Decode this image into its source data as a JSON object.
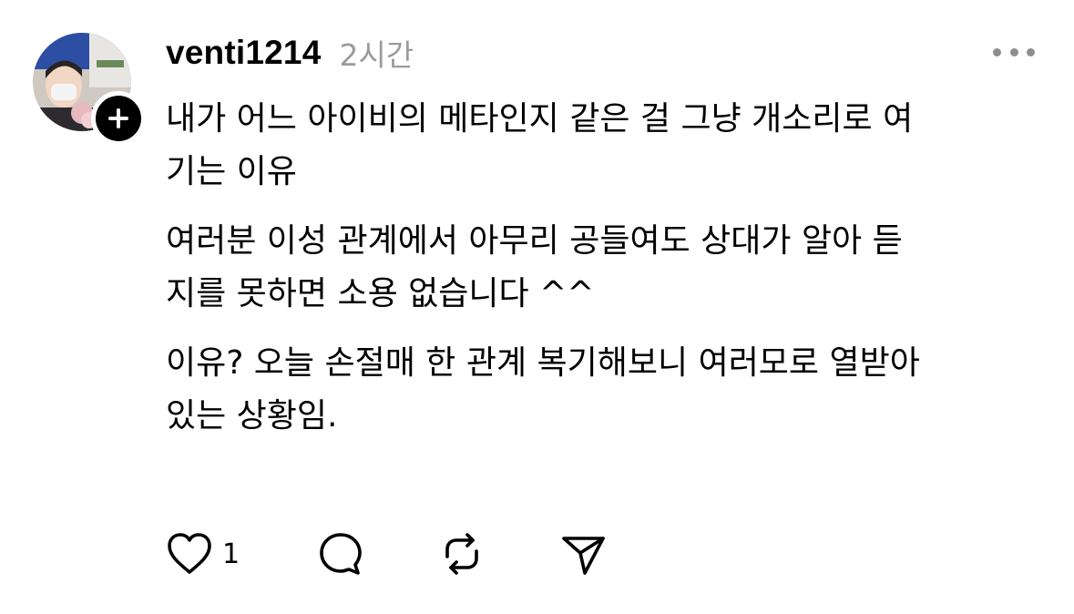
{
  "post": {
    "author": {
      "username": "venti1214",
      "avatar_icon": "profile-photo",
      "follow_icon": "plus-icon"
    },
    "time": "2시간",
    "more_icon": "more-horizontal-icon",
    "paragraphs": [
      "내가 어느 아이비의 메타인지 같은 걸 그냥 개소리로 여\n기는 이유",
      "여러분 이성 관계에서 아무리 공들여도 상대가 알아 듣\n지를 못하면 소용 없습니다 ^^",
      "이유? 오늘 손절매 한 관계 복기해보니 여러모로 열받아\n있는 상황임."
    ],
    "actions": {
      "like_icon": "heart-icon",
      "like_count": "1",
      "comment_icon": "comment-icon",
      "repost_icon": "repost-icon",
      "share_icon": "send-icon"
    }
  },
  "colors": {
    "text": "#000000",
    "muted": "#9b9b9b",
    "icon": "#000000",
    "background": "#ffffff"
  }
}
